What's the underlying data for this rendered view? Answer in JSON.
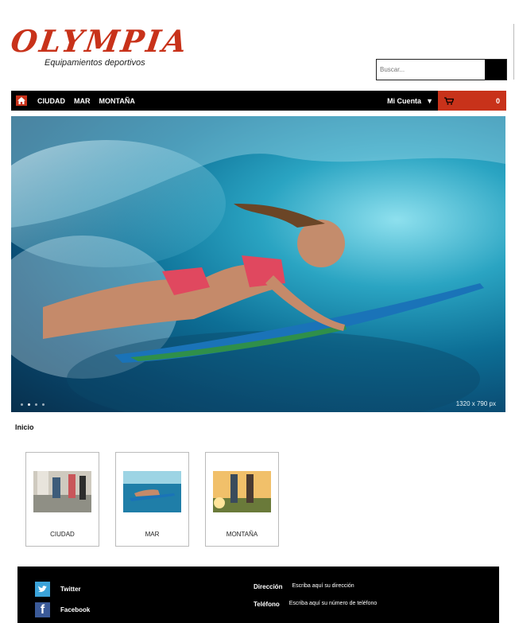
{
  "brand": {
    "name": "OLYMPIA",
    "tagline": "Equipamientos deportivos",
    "accent": "#c8321a"
  },
  "search": {
    "placeholder": "Buscar..."
  },
  "nav": {
    "items": [
      "CIUDAD",
      "MAR",
      "MONTAÑA"
    ],
    "account_label": "Mi Cuenta",
    "cart_count": "0"
  },
  "hero": {
    "dimensions_label": "1320 x 790 px",
    "slides": 4,
    "active_slide": 2
  },
  "breadcrumb": {
    "label": "Inicio"
  },
  "categories": [
    {
      "label": "CIUDAD"
    },
    {
      "label": "MAR"
    },
    {
      "label": "MONTAÑA"
    }
  ],
  "footer": {
    "social": [
      {
        "label": "Twitter",
        "icon": "twitter-icon"
      },
      {
        "label": "Facebook",
        "icon": "facebook-icon"
      }
    ],
    "address_label": "Dirección",
    "address_value": "Escriba aquí su dirección",
    "phone_label": "Teléfono",
    "phone_value": "Escriba aquí su número de teléfono"
  }
}
